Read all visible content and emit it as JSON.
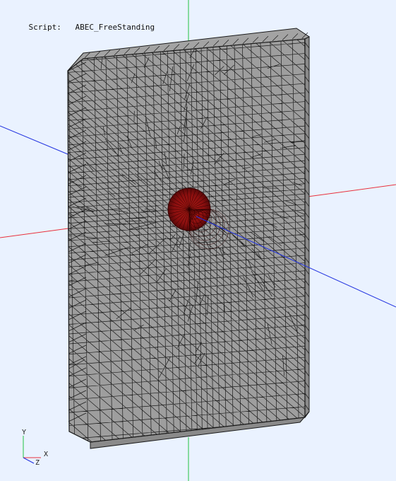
{
  "viewer": {
    "script_label": "Script:",
    "script_name": "ABEC_FreeStanding",
    "background_color": "#eaf2ff"
  },
  "model": {
    "description_icon": "mesh-baffle",
    "surface_color": "#9e9e9e",
    "mesh_line_color": "#1a1a1a",
    "driver_color": "#8b0f0f"
  },
  "axes": {
    "x_color": "#e8323c",
    "y_color": "#22c142",
    "z_color": "#2233e0"
  },
  "triad": {
    "x_label": "X",
    "y_label": "Y",
    "z_label": "Z"
  }
}
